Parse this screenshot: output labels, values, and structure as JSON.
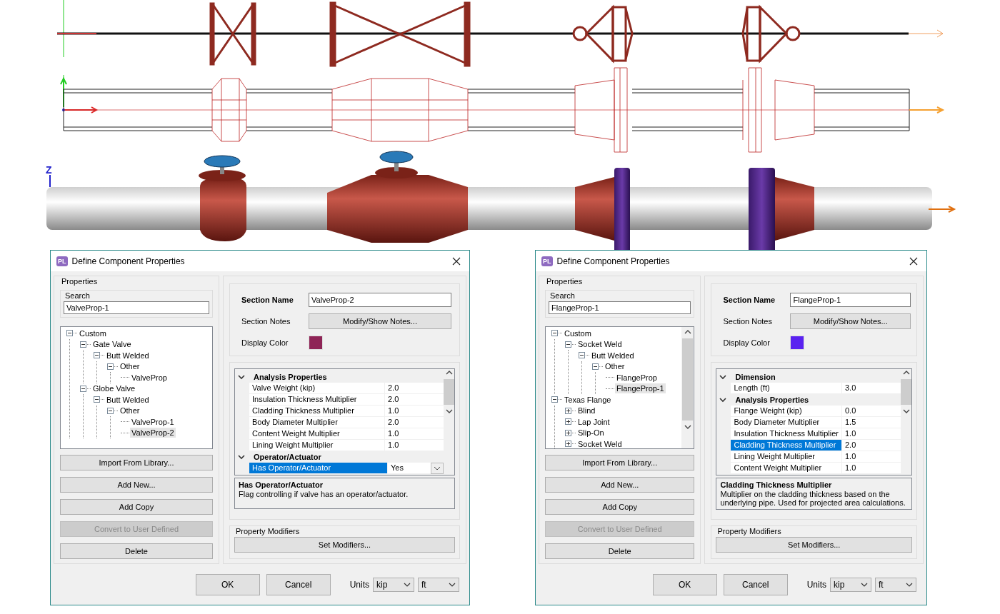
{
  "drawing": {
    "axis_label": "Z"
  },
  "dialogs": [
    {
      "app_badge": "PL",
      "title": "Define Component Properties",
      "properties_label": "Properties",
      "search": {
        "label": "Search",
        "value": "ValveProp-1"
      },
      "tree_scrollbar": false,
      "tree": [
        {
          "label": "Custom",
          "expanded": true,
          "selected": false,
          "children": [
            {
              "label": "Gate Valve",
              "expanded": true,
              "selected": false,
              "children": [
                {
                  "label": "Butt Welded",
                  "expanded": true,
                  "selected": false,
                  "children": [
                    {
                      "label": "Other",
                      "expanded": true,
                      "selected": false,
                      "children": [
                        {
                          "label": "ValveProp",
                          "selected": false
                        }
                      ]
                    }
                  ]
                }
              ]
            },
            {
              "label": "Globe Valve",
              "expanded": true,
              "selected": false,
              "children": [
                {
                  "label": "Butt Welded",
                  "expanded": true,
                  "selected": false,
                  "children": [
                    {
                      "label": "Other",
                      "expanded": true,
                      "selected": false,
                      "children": [
                        {
                          "label": "ValveProp-1",
                          "selected": false
                        },
                        {
                          "label": "ValveProp-2",
                          "selected": true
                        }
                      ]
                    }
                  ]
                }
              ]
            }
          ]
        }
      ],
      "buttons": [
        {
          "label": "Import From Library...",
          "disabled": false
        },
        {
          "label": "Add New...",
          "disabled": false
        },
        {
          "label": "Add Copy",
          "disabled": false
        },
        {
          "label": "Convert to User Defined",
          "disabled": true
        },
        {
          "label": "Delete",
          "disabled": false
        }
      ],
      "section_name": {
        "label": "Section Name",
        "value": "ValveProp-2"
      },
      "section_notes": {
        "label": "Section Notes",
        "button": "Modify/Show Notes..."
      },
      "display_color": {
        "label": "Display Color",
        "color": "#8e2456"
      },
      "grid": [
        {
          "kind": "category",
          "label": "Analysis Properties",
          "expanded": true
        },
        {
          "kind": "property",
          "name": "Valve Weight (kip)",
          "value": "2.0",
          "selected": false
        },
        {
          "kind": "property",
          "name": "Insulation Thickness Multiplier",
          "value": "2.0",
          "selected": false
        },
        {
          "kind": "property",
          "name": "Cladding Thickness Multiplier",
          "value": "1.0",
          "selected": false
        },
        {
          "kind": "property",
          "name": "Body Diameter Multiplier",
          "value": "2.0",
          "selected": false
        },
        {
          "kind": "property",
          "name": "Content Weight Multiplier",
          "value": "1.0",
          "selected": false
        },
        {
          "kind": "property",
          "name": "Lining Weight Multiplier",
          "value": "1.0",
          "selected": false
        },
        {
          "kind": "category",
          "label": "Operator/Actuator",
          "expanded": true
        },
        {
          "kind": "choice",
          "name": "Has Operator/Actuator",
          "value": "Yes",
          "selected": true
        }
      ],
      "description": {
        "title": "Has Operator/Actuator",
        "text": "Flag controlling if valve has an operator/actuator."
      },
      "modifiers": {
        "label": "Property Modifiers",
        "button": "Set Modifiers..."
      },
      "footer": {
        "ok": "OK",
        "cancel": "Cancel",
        "units_label": "Units",
        "units": [
          "kip",
          "ft"
        ]
      }
    },
    {
      "app_badge": "PL",
      "title": "Define Component Properties",
      "properties_label": "Properties",
      "search": {
        "label": "Search",
        "value": "FlangeProp-1"
      },
      "tree_scrollbar": true,
      "tree": [
        {
          "label": "Custom",
          "expanded": true,
          "selected": false,
          "children": [
            {
              "label": "Socket Weld",
              "expanded": true,
              "selected": false,
              "children": [
                {
                  "label": "Butt Welded",
                  "expanded": true,
                  "selected": false,
                  "children": [
                    {
                      "label": "Other",
                      "expanded": true,
                      "selected": false,
                      "children": [
                        {
                          "label": "FlangeProp",
                          "selected": false
                        },
                        {
                          "label": "FlangeProp-1",
                          "selected": true
                        }
                      ]
                    }
                  ]
                }
              ]
            }
          ]
        },
        {
          "label": "Texas Flange",
          "expanded": true,
          "selected": false,
          "children": [
            {
              "label": "Blind",
              "expanded": false,
              "selected": false
            },
            {
              "label": "Lap Joint",
              "expanded": false,
              "selected": false
            },
            {
              "label": "Slip-On",
              "expanded": false,
              "selected": false
            },
            {
              "label": "Socket Weld",
              "expanded": false,
              "selected": false
            }
          ]
        }
      ],
      "buttons": [
        {
          "label": "Import From Library...",
          "disabled": false
        },
        {
          "label": "Add New...",
          "disabled": false
        },
        {
          "label": "Add Copy",
          "disabled": false
        },
        {
          "label": "Convert to User Defined",
          "disabled": true
        },
        {
          "label": "Delete",
          "disabled": false
        }
      ],
      "section_name": {
        "label": "Section Name",
        "value": "FlangeProp-1"
      },
      "section_notes": {
        "label": "Section Notes",
        "button": "Modify/Show Notes..."
      },
      "display_color": {
        "label": "Display Color",
        "color": "#5a22f0"
      },
      "grid": [
        {
          "kind": "category",
          "label": "Dimension",
          "expanded": true
        },
        {
          "kind": "property",
          "name": "Length (ft)",
          "value": "3.0",
          "selected": false
        },
        {
          "kind": "category",
          "label": "Analysis Properties",
          "expanded": true
        },
        {
          "kind": "property",
          "name": "Flange Weight (kip)",
          "value": "0.0",
          "selected": false
        },
        {
          "kind": "property",
          "name": "Body Diameter Multiplier",
          "value": "1.5",
          "selected": false
        },
        {
          "kind": "property",
          "name": "Insulation Thickness Multiplier",
          "value": "1.0",
          "selected": false
        },
        {
          "kind": "property",
          "name": "Cladding Thickness Multiplier",
          "value": "2.0",
          "selected": true
        },
        {
          "kind": "property",
          "name": "Lining Weight Multiplier",
          "value": "1.0",
          "selected": false
        },
        {
          "kind": "property",
          "name": "Content Weight Multiplier",
          "value": "1.0",
          "selected": false
        }
      ],
      "description": {
        "title": "Cladding Thickness Multiplier",
        "text": "Multiplier on the cladding thickness based on the underlying pipe. Used for projected area calculations."
      },
      "modifiers": {
        "label": "Property Modifiers",
        "button": "Set Modifiers..."
      },
      "footer": {
        "ok": "OK",
        "cancel": "Cancel",
        "units_label": "Units",
        "units": [
          "kip",
          "ft"
        ]
      }
    }
  ]
}
